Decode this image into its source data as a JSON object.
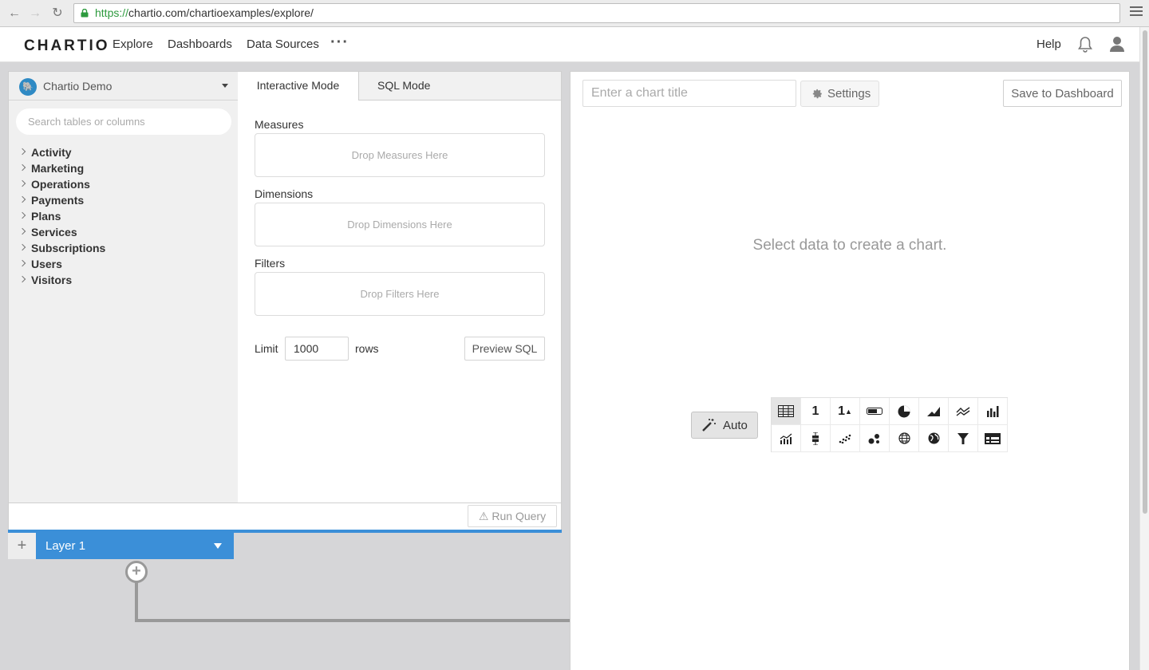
{
  "browser": {
    "url_protocol": "https://",
    "url_rest": "chartio.com/chartioexamples/explore/"
  },
  "header": {
    "logo": "CHARTIO",
    "nav": [
      "Explore",
      "Dashboards",
      "Data Sources"
    ],
    "more": "···",
    "help": "Help"
  },
  "schema": {
    "datasource": "Chartio Demo",
    "datasource_icon": "postgres-elephant-icon",
    "search_placeholder": "Search tables or columns",
    "tables": [
      "Activity",
      "Marketing",
      "Operations",
      "Payments",
      "Plans",
      "Services",
      "Subscriptions",
      "Users",
      "Visitors"
    ]
  },
  "builder": {
    "tab_interactive": "Interactive Mode",
    "tab_sql": "SQL Mode",
    "measures_label": "Measures",
    "measures_drop": "Drop Measures Here",
    "dimensions_label": "Dimensions",
    "dimensions_drop": "Drop Dimensions Here",
    "filters_label": "Filters",
    "filters_drop": "Drop Filters Here",
    "limit_label": "Limit",
    "limit_value": "1000",
    "rows_label": "rows",
    "preview_sql": "Preview SQL",
    "run_query": "Run Query"
  },
  "layer": {
    "add": "+",
    "name": "Layer 1"
  },
  "chart": {
    "title_placeholder": "Enter a chart title",
    "settings": "Settings",
    "save": "Save to Dashboard",
    "empty_message": "Select data to create a chart.",
    "auto": "Auto",
    "types": [
      "table",
      "single-value",
      "single-value-trend",
      "progress-bar",
      "pie",
      "area",
      "line",
      "bar",
      "bar-line",
      "box-plot",
      "scatter",
      "bubble",
      "geo-map",
      "globe-map",
      "funnel",
      "pivot-table"
    ],
    "selected_type": "table",
    "accent": "#3b8fd8"
  }
}
